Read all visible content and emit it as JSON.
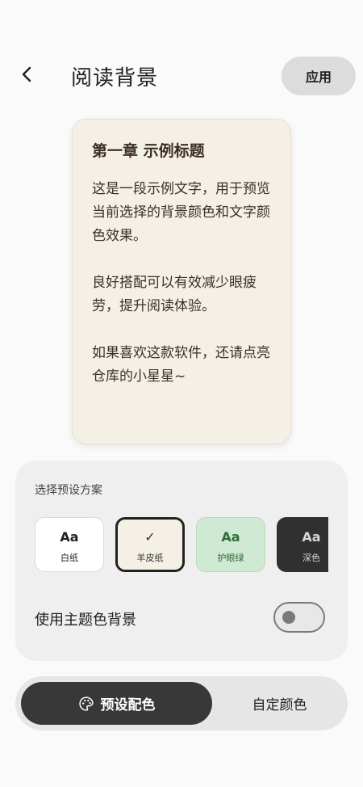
{
  "header": {
    "title": "阅读背景",
    "apply_label": "应用"
  },
  "preview": {
    "title": "第一章 示例标题",
    "paragraphs": [
      "这是一段示例文字，用于预览当前选择的背景颜色和文字颜色效果。",
      "良好搭配可以有效减少眼疲劳，提升阅读体验。",
      "如果喜欢这款软件，还请点亮仓库的小星星~"
    ],
    "background_color": "#f5f0e6",
    "text_color": "#3b2f24"
  },
  "presets": {
    "label": "选择预设方案",
    "items": [
      {
        "main": "Aa",
        "name": "白纸",
        "background": "#ffffff",
        "selected": false
      },
      {
        "main": "✓",
        "name": "羊皮纸",
        "background": "#f5f0e6",
        "selected": true
      },
      {
        "main": "Aa",
        "name": "护眼绿",
        "background": "#cfe9d3",
        "selected": false
      },
      {
        "main": "Aa",
        "name": "深色",
        "background": "#303030",
        "selected": false
      }
    ]
  },
  "theme_toggle": {
    "label": "使用主题色背景",
    "enabled": false
  },
  "segment": {
    "active_label": "预设配色",
    "inactive_label": "自定颜色"
  },
  "icons": {
    "back": "back-arrow-icon",
    "palette": "palette-icon",
    "check": "checkmark-icon"
  }
}
